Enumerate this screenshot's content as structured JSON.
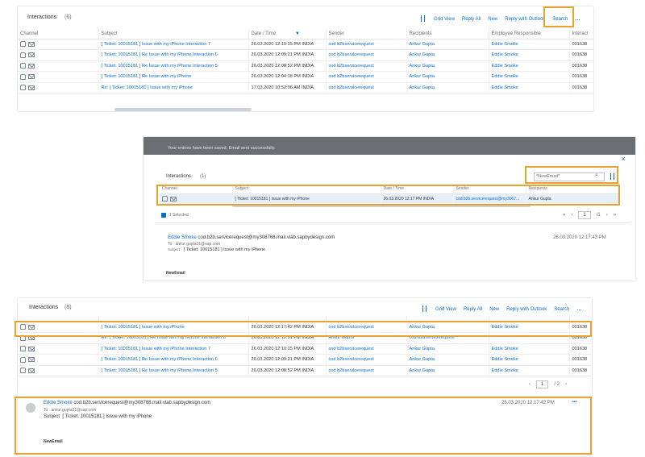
{
  "panel1": {
    "title": "Interactions",
    "count": "(6)",
    "actions": [
      "Grid View",
      "Reply All",
      "New",
      "Reply with Outlook",
      "Search"
    ],
    "more": "...",
    "columns": [
      "Channel",
      "Subject",
      "Date / Time",
      "Sender",
      "Recipients",
      "Employee Responsible",
      "Interact"
    ],
    "rows": [
      {
        "subject": "[ Ticket: 10015181 ] Issue with my iPhone Interaction 7",
        "date": "26.03.2020 12:10:15 PM INDIA",
        "sender": "cod b2bservicerequest",
        "recipient": "Ankur Gupta",
        "employee": "Eddie Smoke",
        "interaction": "001638"
      },
      {
        "subject": "[ Ticket: 10015181 ] Re Issue with my iPhone Interaction 6",
        "date": "26.03.2020 12:09:21 PM INDIA",
        "sender": "cod b2bservicerequest",
        "recipient": "Ankur Gupta",
        "employee": "Eddie Smoke",
        "interaction": "001638"
      },
      {
        "subject": "[ Ticket: 10015181 ] Re Issue with my iPhone Interaction 5",
        "date": "26.03.2020 12:08:52 PM INDIA",
        "sender": "cod b2bservicerequest",
        "recipient": "Ankur Gupta",
        "employee": "Eddie Smoke",
        "interaction": "001638"
      },
      {
        "subject": "[ Ticket: 10015181 ] Re Issue with my iPhone",
        "date": "26.03.2020 12:04:18 PM INDIA",
        "sender": "cod b2bservicerequest",
        "recipient": "Ankur Gupta",
        "employee": "Eddie Smoke",
        "interaction": "001638"
      },
      {
        "subject": "Re: [ Ticket: 10015181 ] Issue with my iPhone",
        "date": "17.03.2020 10:52:06 AM INDIA",
        "sender": "cod b2bservicerequest",
        "recipient": "Ankur Gupta",
        "employee": "Eddie Smoke",
        "interaction": "001638"
      }
    ]
  },
  "panel2": {
    "notice": "Your entries have been saved. Email sent successfully.",
    "close": "×",
    "title": "Interactions",
    "count": "(1)",
    "search_value": "*NewEmail*",
    "columns": [
      "Channel",
      "Subject",
      "Date / Time",
      "Sender",
      "Recipients"
    ],
    "row": {
      "subject": "[ Ticket: 10015181 ] Issue with my iPhone",
      "date": "26.03.2020 12:17 PM INDIA",
      "sender": "cod.b2b.servicerequest@my3067...",
      "recipient": "Ankur Gupta"
    },
    "selected": "1 Selected",
    "page": "1",
    "page_of": "/1",
    "email": {
      "from_name": "Eddie Smoke",
      "from_addr": "cod.b2b.servicerequest@my308768.mail.vlab.sapbydesign.com",
      "to_label": "To",
      "to_addr": "ankur.gupta01@sap.com",
      "subject_label": "Subject",
      "subject": "[ Ticket: 10015181 ] Issue with my iPhone",
      "date": "26.03.2020 12:17:43 PM",
      "body": "NewEmail"
    }
  },
  "panel3": {
    "title": "Interactions",
    "count": "(8)",
    "actions": [
      "Grid View",
      "Reply All",
      "New",
      "Reply with Outlook",
      "Search"
    ],
    "more": "...",
    "rows": [
      {
        "subject": "[ Ticket: 10015181 ] Issue with my iPhone",
        "date": "26.03.2020 12:17:42 PM INDIA",
        "sender": "cod b2bservicerequest",
        "recipient": "Ankur Gupta",
        "employee": "Eddie Smoke",
        "interaction": "001638"
      },
      {
        "subject": "Re: [ Ticket: 10015181 ] Re Issue with my iPhone Interaction 8",
        "date": "26.03.2020 12:12:51 PM INDIA",
        "sender": "Ankur Gupta",
        "recipient": "cod b2bservicerequest",
        "employee": "",
        "interaction": "001638"
      },
      {
        "subject": "[ Ticket: 10015181 ] Issue with my iPhone Interaction 7",
        "date": "26.03.2020 12:10:15 PM INDIA",
        "sender": "cod b2bservicerequest",
        "recipient": "Ankur Gupta",
        "employee": "Eddie Smoke",
        "interaction": "001638"
      },
      {
        "subject": "[ Ticket: 10015181 ] Re Issue with my iPhone Interaction 6",
        "date": "26.03.2020 12:09:21 PM INDIA",
        "sender": "cod b2bservicerequest",
        "recipient": "Ankur Gupta",
        "employee": "Eddie Smoke",
        "interaction": "001638"
      },
      {
        "subject": "[ Ticket: 10015181 ] Re Issue with my iPhone Interaction 5",
        "date": "26.03.2020 12:08:52 PM INDIA",
        "sender": "cod b2bservicerequest",
        "recipient": "Ankur Gupta",
        "employee": "Eddie Smoke",
        "interaction": "001638"
      }
    ],
    "page": "1",
    "page_of": "/ 2",
    "email": {
      "from_name": "Eddie Smoke",
      "from_addr": "cod.b2b.servicerequest@my308768.mail.vlab.sapbydesign.com",
      "to_label": "To",
      "to_addr": "ankur.gupta01@sap.com",
      "subject_label": "Subject",
      "subject": "[ Ticket: 10015181 ] Issue with my iPhone",
      "date": "26.03.2020 12:17:42 PM",
      "more": "•••",
      "body": "NewEmail"
    }
  },
  "colors": {
    "highlight": "#e8a32e",
    "link": "#0a6ed1",
    "selected_row": "#e5f0fa"
  }
}
